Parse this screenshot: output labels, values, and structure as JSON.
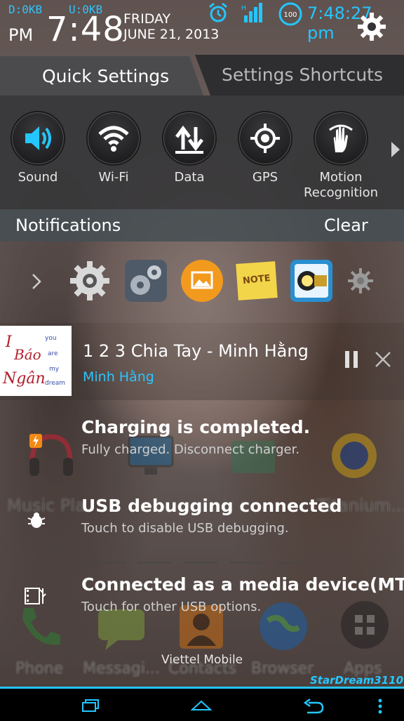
{
  "status_bar": {
    "download": "D:0KB",
    "upload": "U:0KB",
    "ampm": "PM",
    "time": "7:48",
    "day": "FRIDAY",
    "date": "JUNE 21, 2013",
    "battery": "100",
    "clock": "7:48:27 pm",
    "icons": [
      "alarm-icon",
      "signal-icon",
      "battery-icon",
      "settings-gear-icon"
    ]
  },
  "tabs": {
    "quick_settings": "Quick Settings",
    "settings_shortcuts": "Settings Shortcuts"
  },
  "quick_settings": [
    {
      "label": "Sound",
      "icon": "sound-icon",
      "accent": "#2ec4ff"
    },
    {
      "label": "Wi-Fi",
      "icon": "wifi-icon"
    },
    {
      "label": "Data",
      "icon": "data-arrows-icon"
    },
    {
      "label": "GPS",
      "icon": "gps-icon"
    },
    {
      "label": "Motion",
      "label2": "Recognition",
      "icon": "motion-hand-icon"
    }
  ],
  "notifications_header": {
    "title": "Notifications",
    "clear": "Clear"
  },
  "app_shortcuts": [
    "settings-icon",
    "gears-icon",
    "gallery-icon",
    "note-icon",
    "flashlight-icon",
    "small-gear-icon"
  ],
  "music": {
    "title": "1 2 3 Chia Tay - Minh Hằng",
    "artist": "Minh Hằng",
    "album_art_text": [
      "Báo",
      "Ngân",
      "you",
      "are",
      "my",
      "dream"
    ]
  },
  "notifications": [
    {
      "title": "Charging is completed.",
      "subtitle": "Fully charged. Disconnect charger.",
      "icon": "charging-icon"
    },
    {
      "title": "USB debugging connected",
      "subtitle": "Touch to disable USB debugging.",
      "icon": "bug-icon"
    },
    {
      "title": "Connected as a media device(MTP",
      "subtitle": "Touch for other USB options.",
      "icon": "usb-media-icon"
    }
  ],
  "background_ghost": {
    "music_player": "Music Pla",
    "titanium": "Titanium...",
    "dock": [
      "Phone",
      "Messagi...",
      "Contacts",
      "Browser",
      "Apps"
    ]
  },
  "carrier": "Viettel Mobile",
  "signature": "StarDream3110",
  "colors": {
    "accent": "#23c6ff",
    "panel": "#4b4b4d",
    "tab_inactive": "#2e2e30"
  }
}
